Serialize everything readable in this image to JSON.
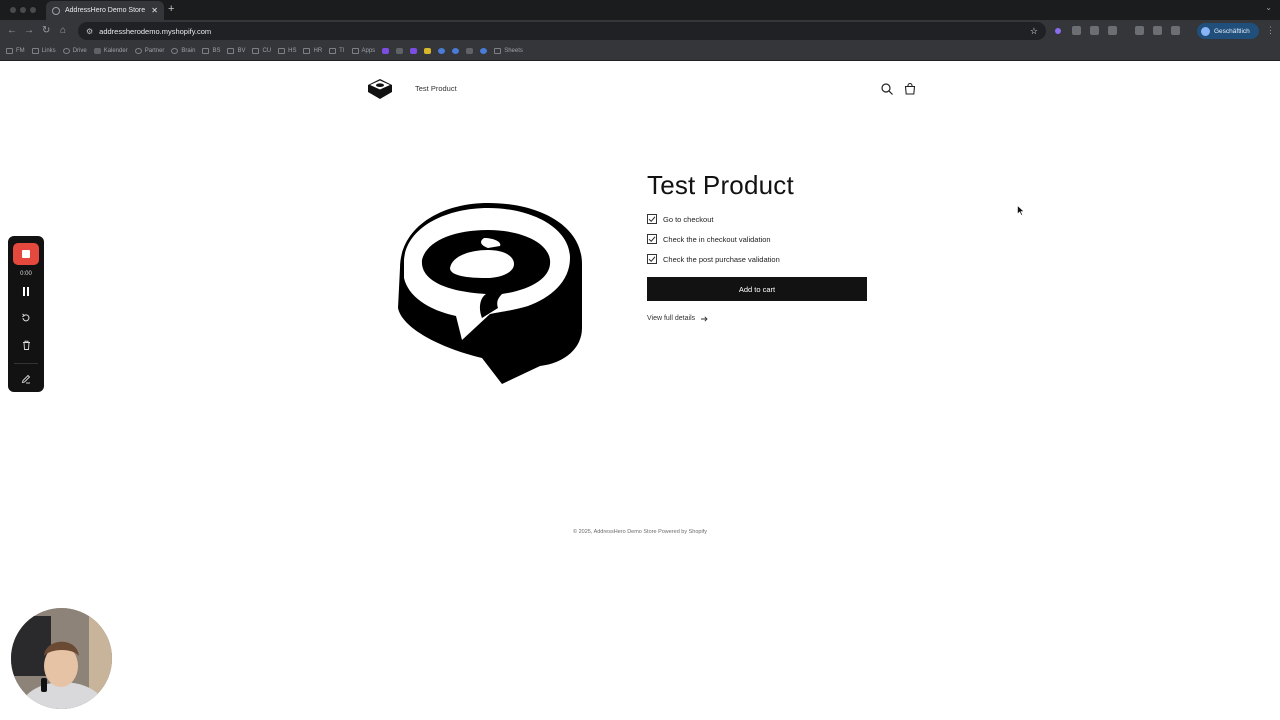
{
  "browser": {
    "tab_title": "AddressHero Demo Store",
    "new_tab_label": "+",
    "url": "addressherodemo.myshopify.com",
    "profile_label": "Geschäftlich",
    "bookmarks": [
      {
        "label": "FM",
        "icon": "folder-icon"
      },
      {
        "label": "Links",
        "icon": "folder-icon"
      },
      {
        "label": "Drive",
        "icon": "drive-icon"
      },
      {
        "label": "Kalender",
        "icon": "calendar-icon"
      },
      {
        "label": "Partner",
        "icon": "shopify-icon"
      },
      {
        "label": "Brain",
        "icon": "brain-icon"
      },
      {
        "label": "BS",
        "icon": "folder-icon"
      },
      {
        "label": "BV",
        "icon": "folder-icon"
      },
      {
        "label": "CU",
        "icon": "folder-icon"
      },
      {
        "label": "HS",
        "icon": "folder-icon"
      },
      {
        "label": "HR",
        "icon": "folder-icon"
      },
      {
        "label": "TI",
        "icon": "folder-icon"
      },
      {
        "label": "Apps",
        "icon": "folder-icon"
      },
      {
        "label": "",
        "icon": "app-icon"
      },
      {
        "label": "",
        "icon": "app-icon"
      },
      {
        "label": "",
        "icon": "app-icon"
      },
      {
        "label": "",
        "icon": "app-icon"
      },
      {
        "label": "",
        "icon": "app-icon"
      },
      {
        "label": "",
        "icon": "app-icon"
      },
      {
        "label": "",
        "icon": "app-icon"
      },
      {
        "label": "",
        "icon": "app-icon"
      },
      {
        "label": "Sheets",
        "icon": "folder-icon"
      }
    ]
  },
  "store": {
    "nav_link": "Test Product",
    "product": {
      "title": "Test Product",
      "options": [
        {
          "label": "Go to checkout",
          "checked": true
        },
        {
          "label": "Check the in checkout validation",
          "checked": true
        },
        {
          "label": "Check the post purchase validation",
          "checked": true
        }
      ],
      "add_to_cart": "Add to cart",
      "view_details": "View full details"
    },
    "footer": "© 2025, AddressHero Demo Store Powered by Shopify"
  },
  "recorder": {
    "time": "0:00",
    "stop_color": "#e5483c"
  },
  "colors": {
    "primary_button": "#121212",
    "chrome_bg": "#202124"
  }
}
